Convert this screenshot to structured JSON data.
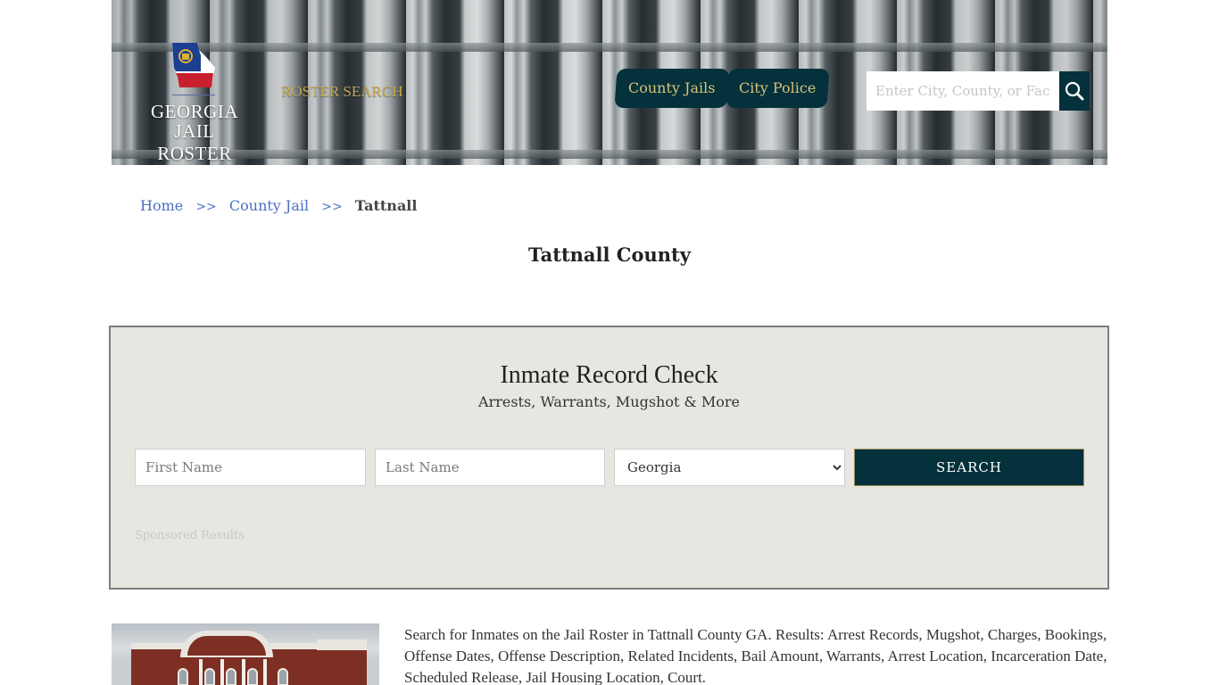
{
  "header": {
    "logo_line1": "GEORGIA",
    "logo_line2": "JAIL ROSTER",
    "roster_search_label": "ROSTER SEARCH",
    "nav_tabs": [
      {
        "label": "County Jails"
      },
      {
        "label": "City Police"
      }
    ],
    "search": {
      "placeholder": "Enter City, County, or Facility",
      "value": "",
      "button_icon": "search-icon"
    }
  },
  "breadcrumb": {
    "items": [
      {
        "label": "Home"
      },
      {
        "label": "County Jail"
      }
    ],
    "separator": ">>",
    "current": "Tattnall"
  },
  "page": {
    "title": "Tattnall County"
  },
  "record_check": {
    "title": "Inmate Record Check",
    "subtitle": "Arrests, Warrants, Mugshot & More",
    "first_name_placeholder": "First Name",
    "last_name_placeholder": "Last Name",
    "state_selected": "Georgia",
    "search_button": "SEARCH",
    "sponsored_label": "Sponsored Results"
  },
  "content": {
    "description": "Search for Inmates on the Jail Roster in Tattnall County GA. Results: Arrest Records, Mugshot, Charges, Bookings, Offense Dates, Offense Description, Related Incidents, Bail Amount, Warrants, Arrest Location, Incarceration Date, Scheduled Release, Jail Housing Location, Court."
  },
  "colors": {
    "brand_dark": "#04313b",
    "gold": "#c8a84c",
    "link": "#4a6fc2",
    "panel_bg": "#e8e6e1"
  }
}
